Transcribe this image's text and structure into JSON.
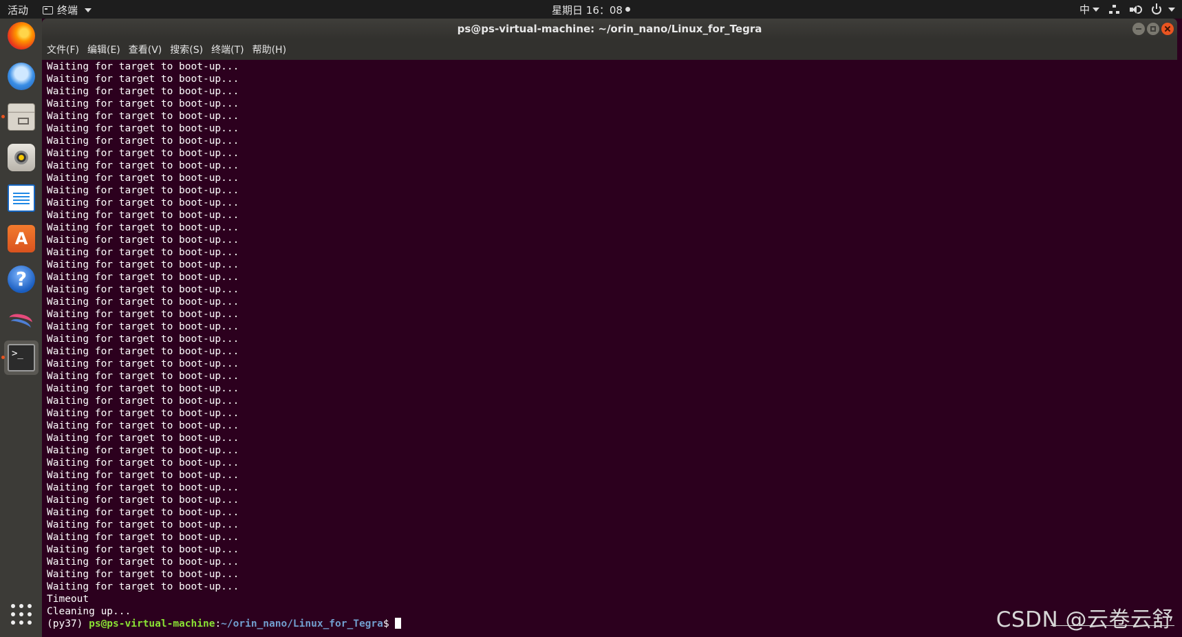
{
  "top_panel": {
    "activities": "活动",
    "app_name": "终端",
    "clock": "星期日 16：08",
    "input_method": "中"
  },
  "dock": {
    "items": [
      {
        "name": "firefox-icon"
      },
      {
        "name": "thunderbird-icon"
      },
      {
        "name": "files-icon"
      },
      {
        "name": "rhythmbox-icon"
      },
      {
        "name": "libreoffice-writer-icon"
      },
      {
        "name": "software-center-icon",
        "glyph": "A"
      },
      {
        "name": "help-icon",
        "glyph": "?"
      },
      {
        "name": "kali-icon"
      },
      {
        "name": "terminal-icon",
        "glyph": ">_"
      }
    ]
  },
  "window": {
    "title": "ps@ps-virtual-machine: ~/orin_nano/Linux_for_Tegra",
    "menu": [
      "文件(F)",
      "编辑(E)",
      "查看(V)",
      "搜索(S)",
      "终端(T)",
      "帮助(H)"
    ]
  },
  "terminal": {
    "repeated_line": "Waiting for target to boot-up...",
    "repeated_count": 43,
    "lines_after": [
      "Timeout",
      "Cleaning up..."
    ],
    "prompt": {
      "env": "(py37) ",
      "user_host": "ps@ps-virtual-machine",
      "sep": ":",
      "path": "~/orin_nano/Linux_for_Tegra",
      "symbol": "$ "
    }
  },
  "watermark": "CSDN @云卷云舒"
}
